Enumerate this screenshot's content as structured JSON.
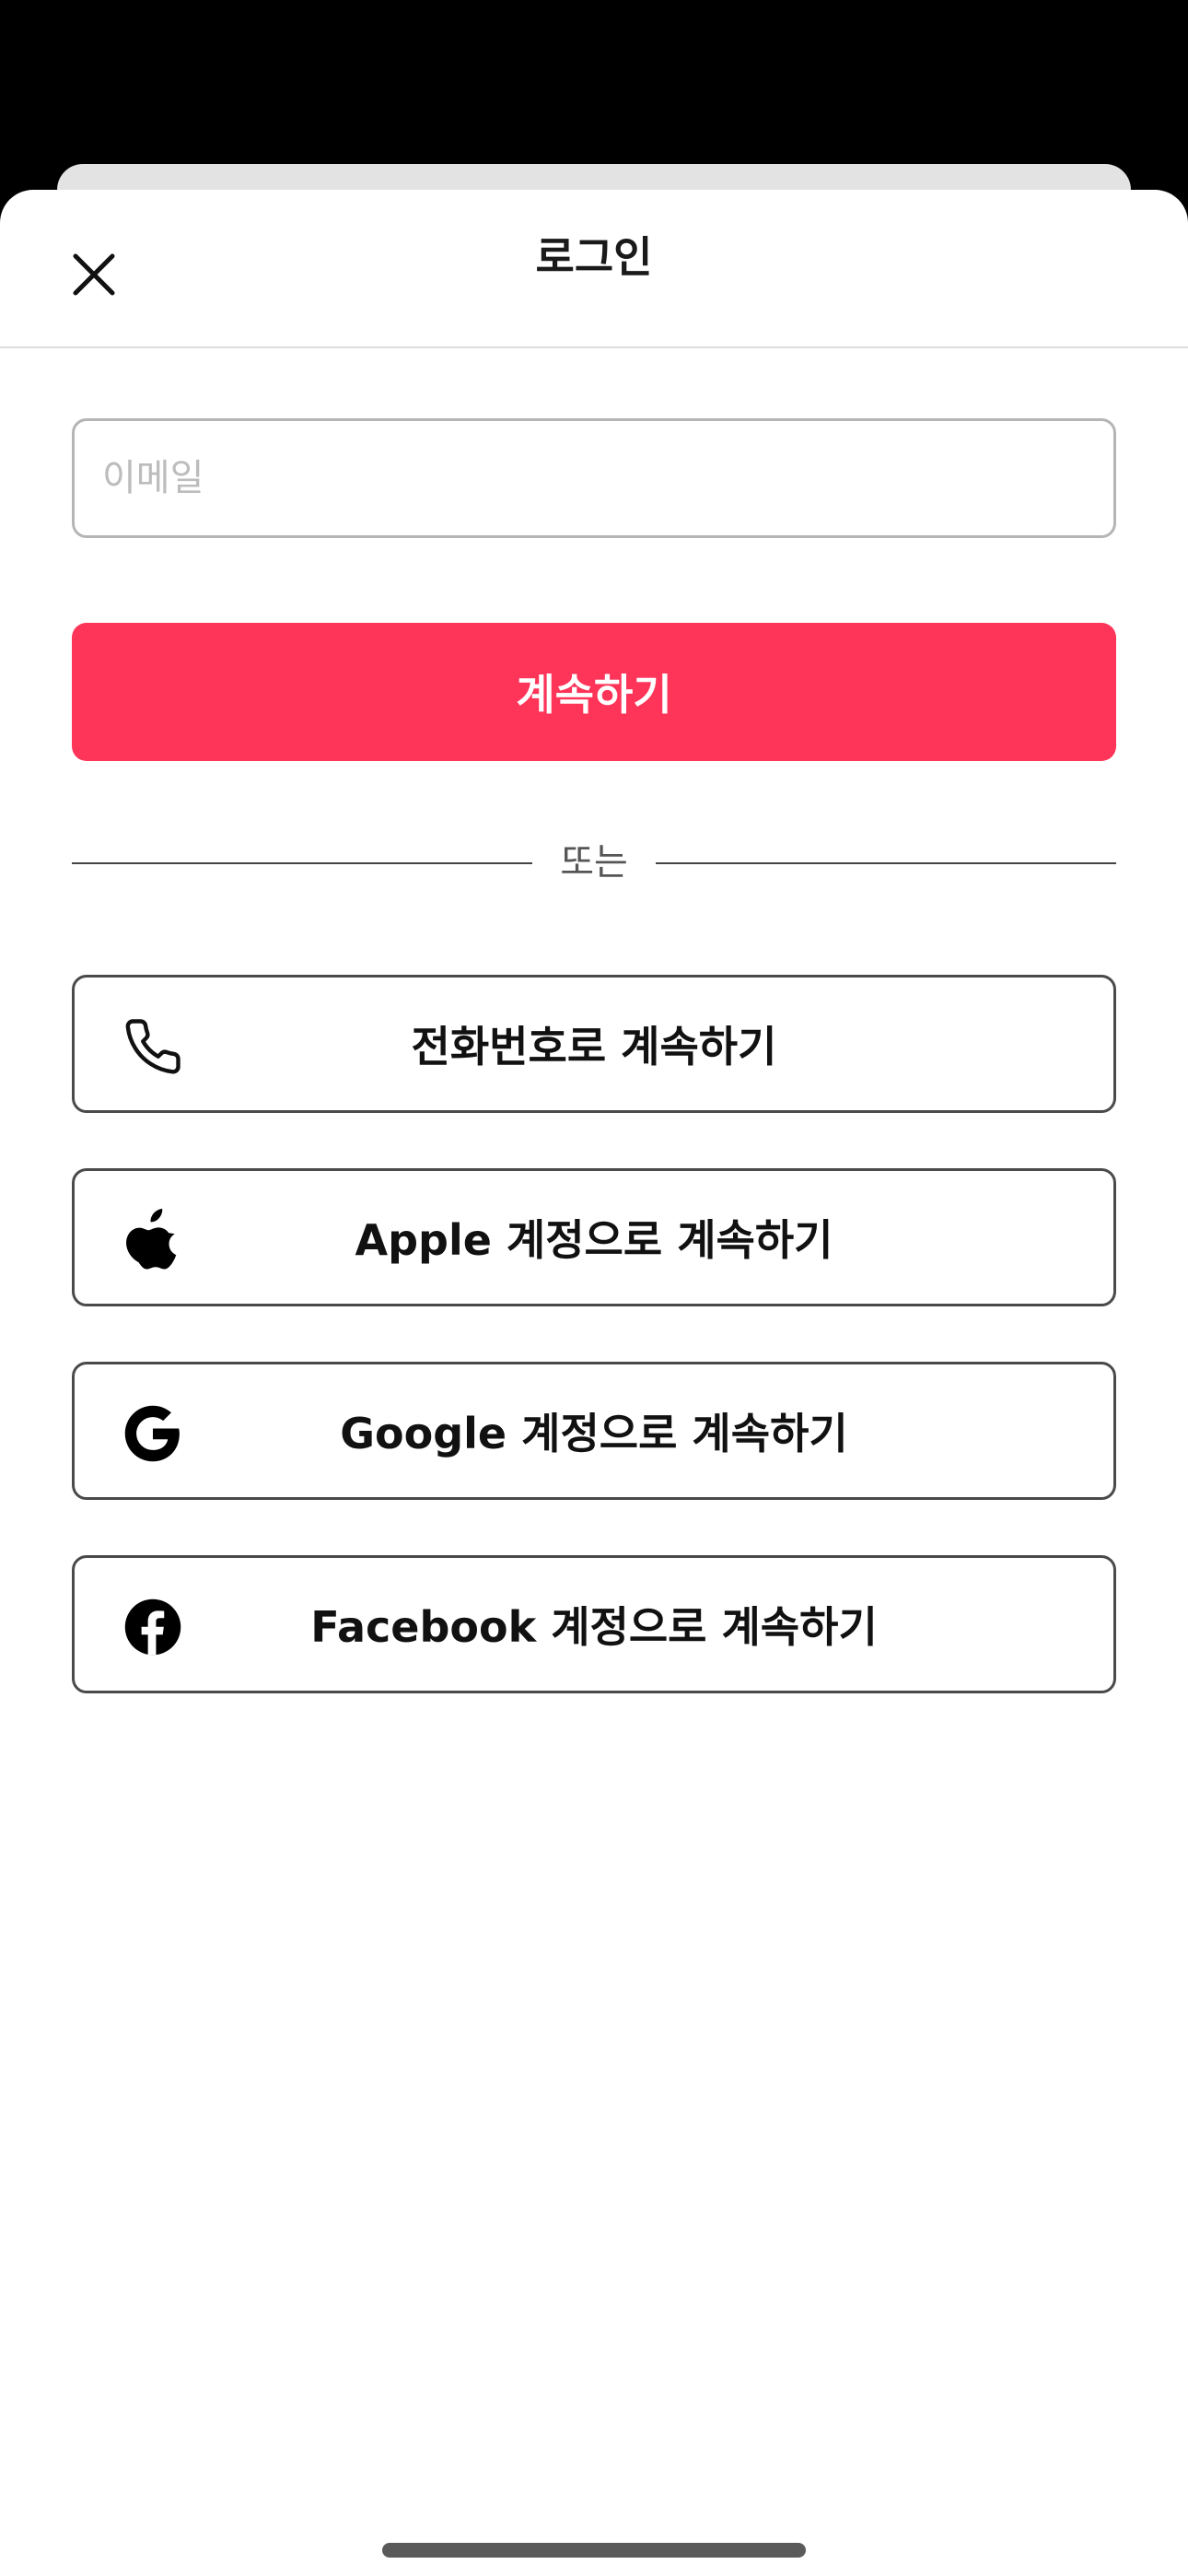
{
  "header": {
    "title": "로그인",
    "close_icon": "close-icon"
  },
  "email": {
    "placeholder": "이메일",
    "value": ""
  },
  "continue_button": {
    "label": "계속하기",
    "color": "#fe3459"
  },
  "divider": {
    "text": "또는"
  },
  "social_buttons": [
    {
      "icon": "phone-icon",
      "label": "전화번호로 계속하기"
    },
    {
      "icon": "apple-icon",
      "label": "Apple 계정으로 계속하기"
    },
    {
      "icon": "google-icon",
      "label": "Google 계정으로 계속하기"
    },
    {
      "icon": "facebook-icon",
      "label": "Facebook 계정으로 계속하기"
    }
  ]
}
